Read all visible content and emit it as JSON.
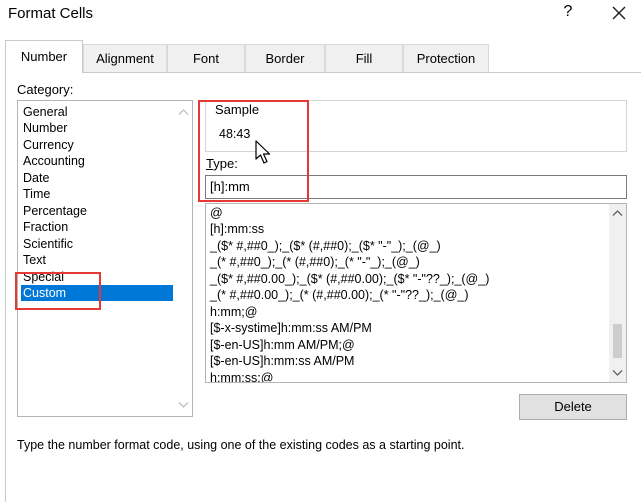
{
  "window": {
    "title": "Format Cells",
    "help_label": "?",
    "close_icon": "close-icon"
  },
  "tabs": [
    {
      "label": "Number",
      "active": true
    },
    {
      "label": "Alignment",
      "active": false
    },
    {
      "label": "Font",
      "active": false
    },
    {
      "label": "Border",
      "active": false
    },
    {
      "label": "Fill",
      "active": false
    },
    {
      "label": "Protection",
      "active": false
    }
  ],
  "category": {
    "label": "Category:",
    "items": [
      "General",
      "Number",
      "Currency",
      "Accounting",
      "Date",
      "Time",
      "Percentage",
      "Fraction",
      "Scientific",
      "Text",
      "Special",
      "Custom"
    ],
    "selected": "Custom"
  },
  "sample": {
    "label": "Sample",
    "value": "48:43"
  },
  "type": {
    "label": "Type:",
    "value": "[h]:mm"
  },
  "format_list": {
    "items": [
      "@",
      "[h]:mm:ss",
      "_($* #,##0_);_($* (#,##0);_($* \"-\"_);_(@_)",
      "_(* #,##0_);_(* (#,##0);_(* \"-\"_);_(@_)",
      "_($* #,##0.00_);_($* (#,##0.00);_($* \"-\"??_);_(@_)",
      "_(* #,##0.00_);_(* (#,##0.00);_(* \"-\"??_);_(@_)",
      "h:mm;@",
      "[$-x-systime]h:mm:ss AM/PM",
      "[$-en-US]h:mm AM/PM;@",
      "[$-en-US]h:mm:ss AM/PM",
      "h:mm:ss;@"
    ]
  },
  "delete_button": {
    "label": "Delete"
  },
  "hint": "Type the number format code, using one of the existing codes as a starting point.",
  "colors": {
    "selection": "#0078d7",
    "highlight": "#e53935"
  }
}
